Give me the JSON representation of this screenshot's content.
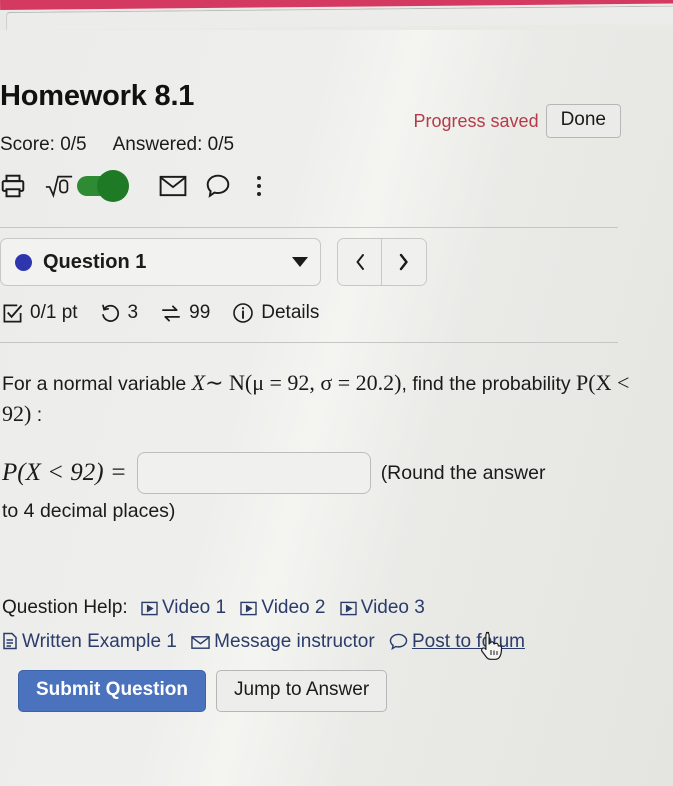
{
  "browser": {
    "accent_bar_color": "#d43a61"
  },
  "header": {
    "title": "Homework 8.1",
    "progress_status": "Progress saved",
    "progress_status_color": "#b63a4a",
    "done_label": "Done",
    "score_label": "Score: 0/5",
    "answered_label": "Answered: 0/5"
  },
  "toolbar": {
    "icons": [
      {
        "name": "print-icon",
        "label": "Print"
      },
      {
        "name": "math-preview-icon",
        "label": "√0"
      },
      {
        "name": "math-preview-toggle",
        "label": "On",
        "color": "#1f7a26"
      },
      {
        "name": "mail-icon",
        "label": "Mail"
      },
      {
        "name": "chat-icon",
        "label": "Chat"
      },
      {
        "name": "kebab-menu-icon",
        "label": "More"
      }
    ]
  },
  "question_selector": {
    "selected": "Question 1",
    "status_dot_color": "#2e35ad",
    "prev_label": "‹",
    "next_label": "›"
  },
  "meta": {
    "points": "0/1 pt",
    "attempts": "3",
    "versions": "99",
    "details_label": "Details"
  },
  "question": {
    "line1_pre": "For a normal variable",
    "var_x": "X",
    "tilde": "∼",
    "dist": "N(μ = 92, σ = 20.2)",
    "line1_post": ", find the",
    "line2_pre": "probability",
    "prob_expr": "P(X < 92)",
    "line2_post": ":",
    "answer_lhs": "P(X < 92) =",
    "answer_value": "",
    "answer_placeholder": "",
    "round_note": "(Round the answer",
    "round_note2": "to 4 decimal places)"
  },
  "help": {
    "label": "Question Help:",
    "links": [
      {
        "name": "video-1",
        "icon": "video-icon",
        "text": "Video 1",
        "underlined": false
      },
      {
        "name": "video-2",
        "icon": "video-icon",
        "text": "Video 2",
        "underlined": false
      },
      {
        "name": "video-3",
        "icon": "video-icon",
        "text": "Video 3",
        "underlined": false
      },
      {
        "name": "written-example-1",
        "icon": "document-icon",
        "text": "Written Example 1",
        "underlined": false
      },
      {
        "name": "message-instructor",
        "icon": "envelope-icon",
        "text": "Message instructor",
        "underlined": false
      },
      {
        "name": "post-to-forum",
        "icon": "chat-bubble-icon",
        "text": "Post to forum",
        "underlined": true
      }
    ],
    "link_color": "#2b3c6b"
  },
  "actions": {
    "submit_label": "Submit Question",
    "submit_color": "#4a72bd",
    "jump_label": "Jump to Answer"
  }
}
